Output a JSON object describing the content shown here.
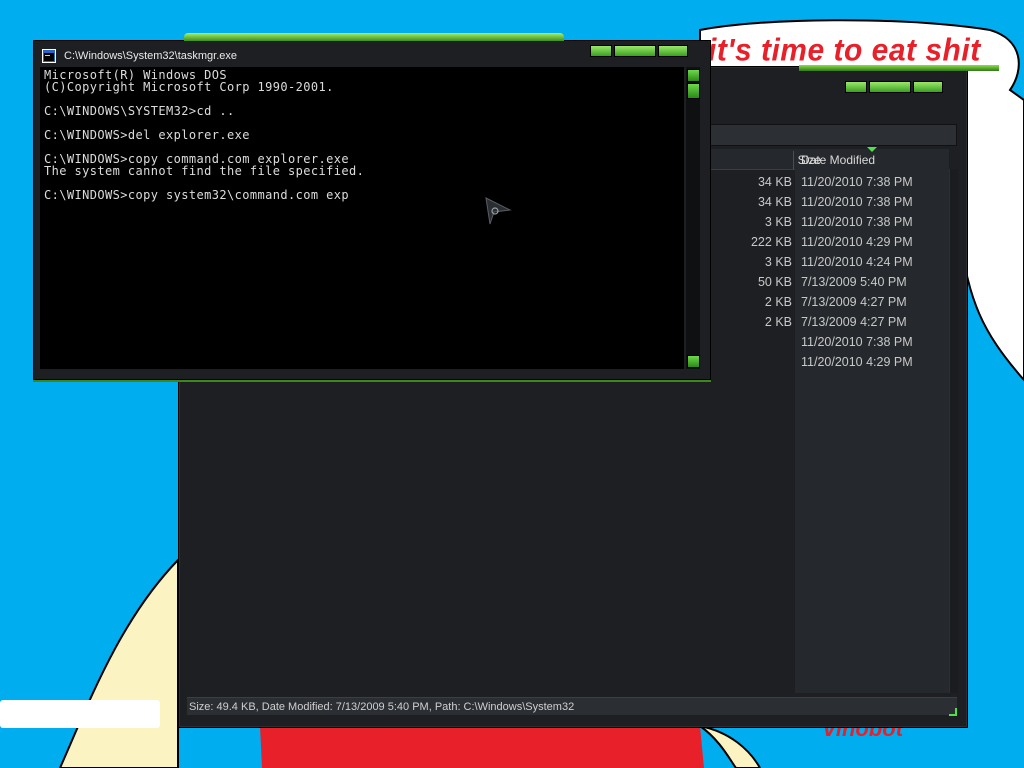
{
  "background": {
    "speech_bubble_text": "it's time to eat shit",
    "signature_text": "Vinobot",
    "colors": {
      "sky": "#00aeef",
      "bubble": "#ffffff",
      "shirt_red": "#e8202a",
      "skin": "#fbf3c2"
    }
  },
  "explorer": {
    "columns": {
      "size": "Size",
      "date_modified": "Date Modified"
    },
    "rows": [
      {
        "size": "34 KB",
        "date": "11/20/2010 7:38 PM"
      },
      {
        "size": "34 KB",
        "date": "11/20/2010 7:38 PM"
      },
      {
        "size": "3 KB",
        "date": "11/20/2010 7:38 PM"
      },
      {
        "size": "222 KB",
        "date": "11/20/2010 4:29 PM"
      },
      {
        "size": "3 KB",
        "date": "11/20/2010 4:24 PM"
      },
      {
        "size": "50 KB",
        "date": "7/13/2009 5:40 PM"
      },
      {
        "size": "2 KB",
        "date": "7/13/2009 4:27 PM"
      },
      {
        "size": "2 KB",
        "date": "7/13/2009 4:27 PM"
      },
      {
        "size": "",
        "date": "11/20/2010 7:38 PM"
      },
      {
        "size": "",
        "date": "11/20/2010 4:29 PM"
      }
    ],
    "status_bar": "Size: 49.4 KB, Date Modified: 7/13/2009 5:40 PM, Path: C:\\Windows\\System32"
  },
  "cmd": {
    "title": "C:\\Windows\\System32\\taskmgr.exe",
    "icon": "console-window-icon",
    "console_lines": [
      "Microsoft(R) Windows DOS",
      "(C)Copyright Microsoft Corp 1990-2001.",
      "",
      "C:\\WINDOWS\\SYSTEM32>cd ..",
      "",
      "C:\\WINDOWS>del explorer.exe",
      "",
      "C:\\WINDOWS>copy command.com explorer.exe",
      "The system cannot find the file specified.",
      "",
      "C:\\WINDOWS>copy system32\\command.com exp"
    ]
  }
}
